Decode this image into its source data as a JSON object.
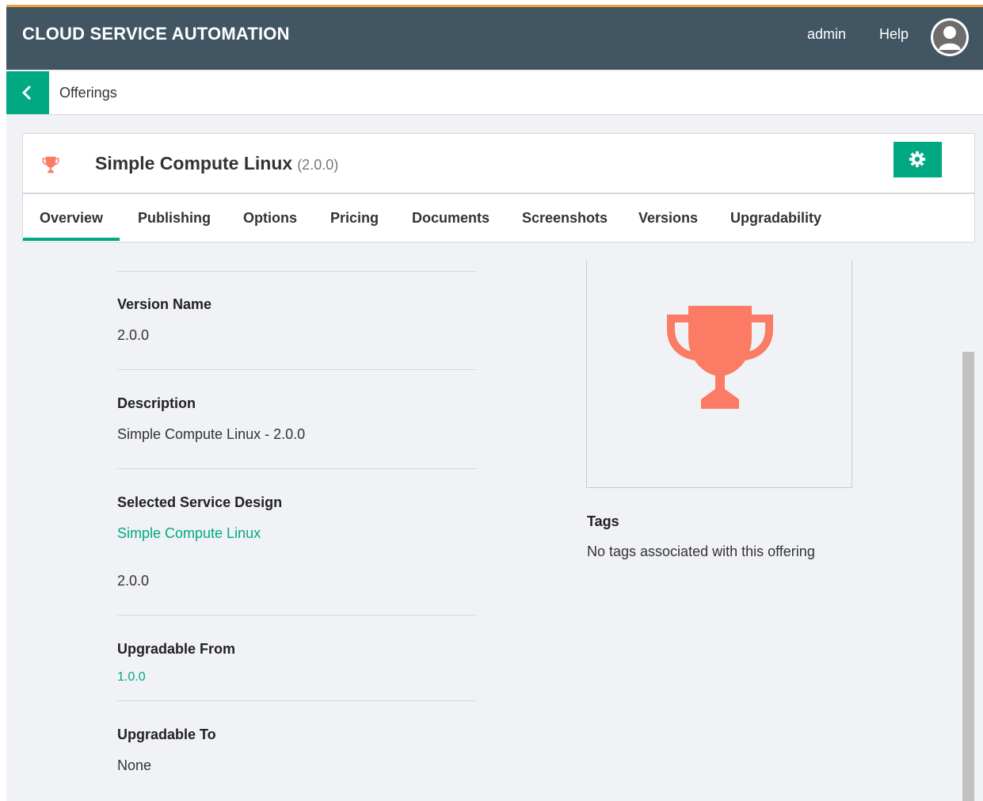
{
  "header": {
    "app_title": "CLOUD SERVICE AUTOMATION",
    "user": "admin",
    "help": "Help"
  },
  "breadcrumb": {
    "label": "Offerings"
  },
  "offering": {
    "name": "Simple Compute Linux",
    "version": "(2.0.0)"
  },
  "tabs": [
    {
      "label": "Overview",
      "active": true
    },
    {
      "label": "Publishing"
    },
    {
      "label": "Options"
    },
    {
      "label": "Pricing"
    },
    {
      "label": "Documents"
    },
    {
      "label": "Screenshots"
    },
    {
      "label": "Versions"
    },
    {
      "label": "Upgradability"
    }
  ],
  "overview": {
    "version_name": {
      "label": "Version Name",
      "value": "2.0.0"
    },
    "description": {
      "label": "Description",
      "value": "Simple Compute Linux - 2.0.0"
    },
    "service_design": {
      "label": "Selected Service Design",
      "link": "Simple Compute Linux",
      "version": "2.0.0"
    },
    "upgradable_from": {
      "label": "Upgradable From",
      "link": "1.0.0"
    },
    "upgradable_to": {
      "label": "Upgradable To",
      "value": "None"
    }
  },
  "tags": {
    "label": "Tags",
    "value": "No tags associated with this offering"
  },
  "icons": {
    "back": "chevron-left-icon",
    "gear": "gear-icon",
    "trophy": "trophy-icon",
    "avatar": "user-avatar-icon"
  },
  "colors": {
    "header": "#425563",
    "accent": "#01a982",
    "trophy": "#fb7b64",
    "top_stripe": "#f0a236"
  }
}
